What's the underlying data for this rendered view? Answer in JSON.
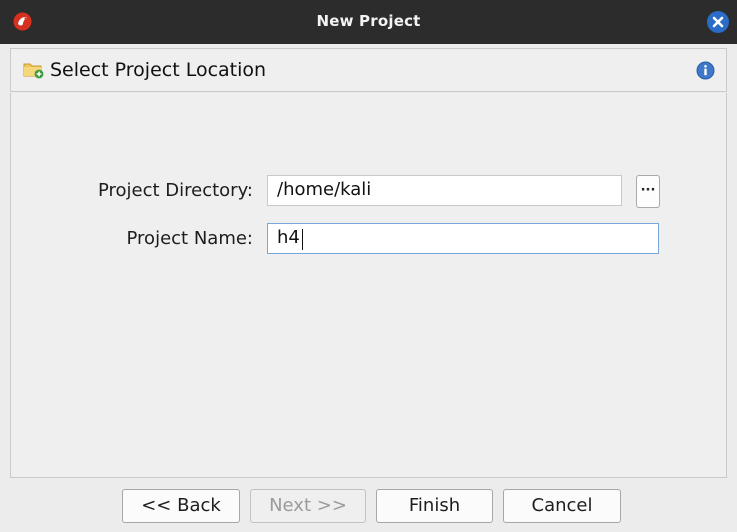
{
  "window": {
    "title": "New Project"
  },
  "header": {
    "title": "Select Project Location"
  },
  "form": {
    "directory_label": "Project Directory:",
    "directory_value": "/home/kali",
    "browse_label": "···",
    "name_label": "Project Name:",
    "name_value": "h4"
  },
  "buttons": {
    "back": "<< Back",
    "next": "Next >>",
    "finish": "Finish",
    "cancel": "Cancel"
  },
  "colors": {
    "titlebar": "#2c2c2c",
    "close_button": "#2a6cc7",
    "focus_border": "#7aa6d9"
  }
}
